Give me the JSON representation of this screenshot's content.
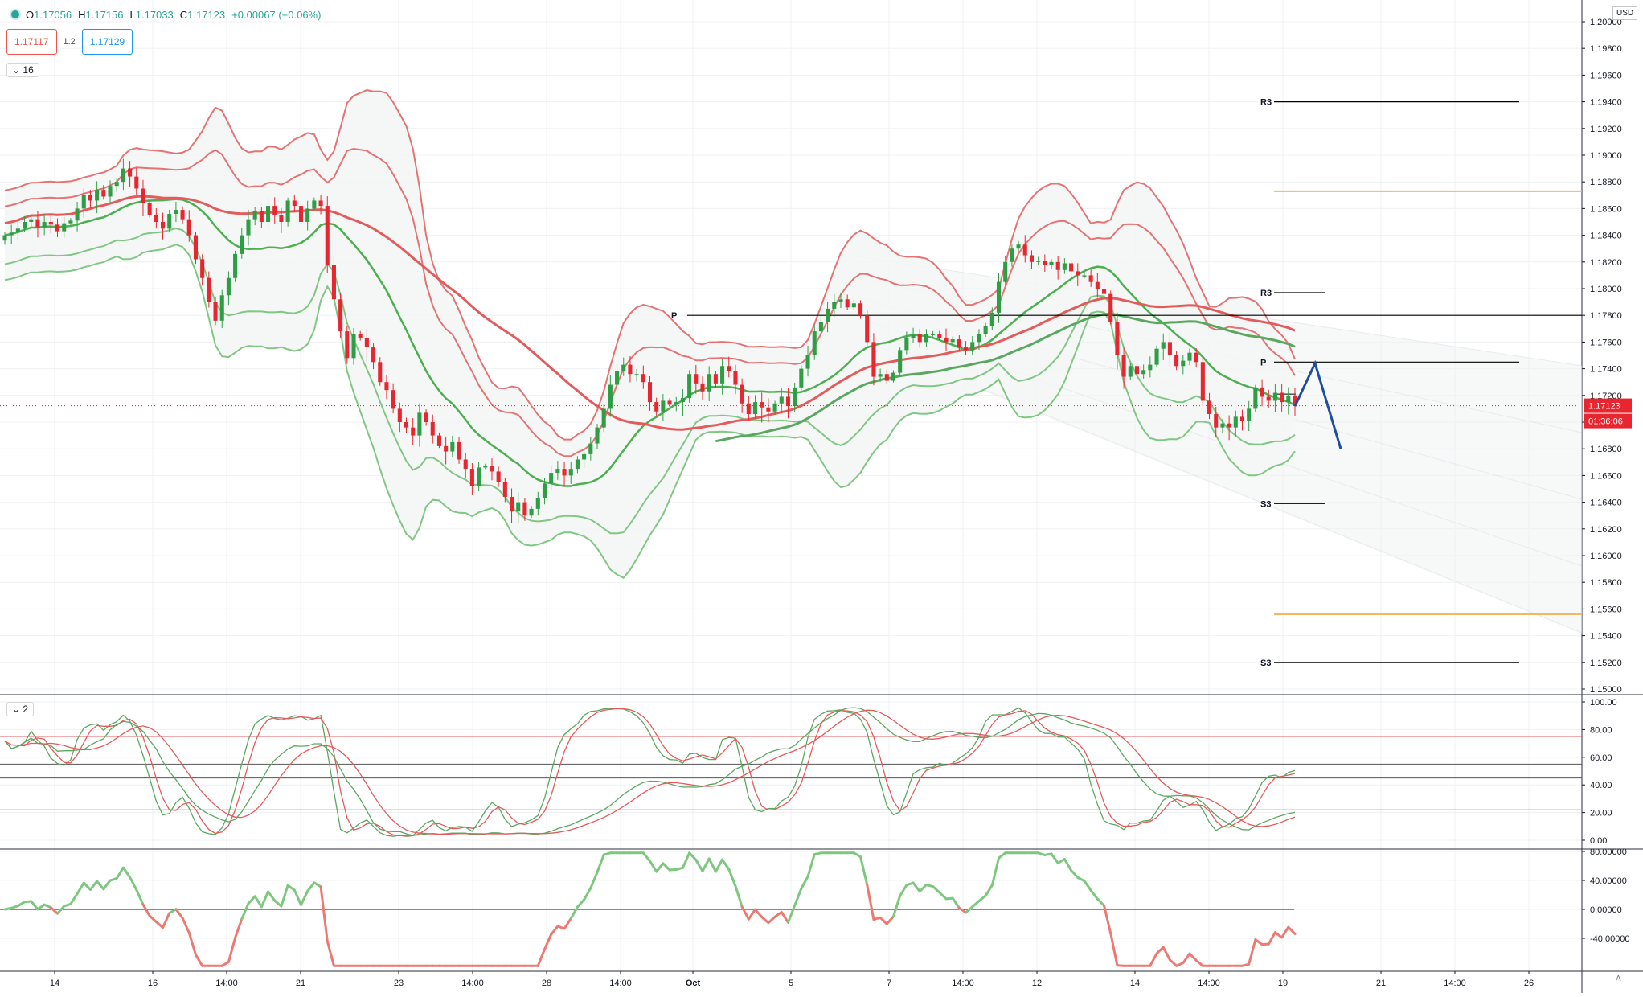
{
  "header": {
    "ohlc": [
      {
        "label": "O",
        "value": "1.17056"
      },
      {
        "label": "H",
        "value": "1.17156"
      },
      {
        "label": "L",
        "value": "1.17033"
      },
      {
        "label": "C",
        "value": "1.17123"
      },
      {
        "label": "",
        "value": "+0.00067 (+0.06%)"
      }
    ],
    "sell_price": "1.17117",
    "spread": "1.2",
    "buy_price": "1.17129",
    "main_collapse_count": "16",
    "osc_collapse_count": "2",
    "currency": "USD",
    "corner_label": "A"
  },
  "colors": {
    "up": "#2e9e45",
    "down": "#e8262f",
    "upper_band": "#e57373",
    "lower_band": "#81c784",
    "pivot_line": "#000000",
    "projection": "#1f4e9c",
    "orange": "#f0b860"
  },
  "chart_data": [
    {
      "type": "candlestick",
      "name": "price",
      "x_ticks": [
        "14",
        "16",
        "14:00",
        "21",
        "23",
        "14:00",
        "28",
        "14:00",
        "Oct",
        "5",
        "7",
        "14:00",
        "12",
        "14",
        "14:00",
        "19",
        "21",
        "14:00",
        "26"
      ],
      "y_ticks": [
        "1.20000",
        "1.19800",
        "1.19600",
        "1.19400",
        "1.19200",
        "1.19000",
        "1.18800",
        "1.18600",
        "1.18400",
        "1.18200",
        "1.18000",
        "1.17800",
        "1.17600",
        "1.17400",
        "1.17200",
        "1.17000",
        "1.16800",
        "1.16600",
        "1.16400",
        "1.16200",
        "1.16000",
        "1.15800",
        "1.15600",
        "1.15400",
        "1.15200",
        "1.15000"
      ],
      "ylim": [
        1.1495,
        1.2012
      ],
      "last_price": "1.17123",
      "countdown": "01:36:06",
      "closes": [
        1.184,
        1.1842,
        1.1845,
        1.185,
        1.1852,
        1.1846,
        1.185,
        1.1848,
        1.1843,
        1.1849,
        1.1851,
        1.186,
        1.187,
        1.1866,
        1.1874,
        1.1869,
        1.1877,
        1.188,
        1.189,
        1.1884,
        1.1875,
        1.1864,
        1.1855,
        1.185,
        1.1845,
        1.1856,
        1.1859,
        1.1852,
        1.184,
        1.1822,
        1.1808,
        1.179,
        1.1776,
        1.1795,
        1.1808,
        1.1826,
        1.184,
        1.1852,
        1.1858,
        1.185,
        1.1862,
        1.1855,
        1.185,
        1.1866,
        1.1862,
        1.185,
        1.186,
        1.1866,
        1.1862,
        1.1818,
        1.1792,
        1.1768,
        1.1748,
        1.1766,
        1.1763,
        1.1756,
        1.1745,
        1.173,
        1.1724,
        1.171,
        1.17,
        1.1696,
        1.169,
        1.1707,
        1.17,
        1.169,
        1.1682,
        1.1678,
        1.1685,
        1.1672,
        1.1665,
        1.1652,
        1.1666,
        1.1667,
        1.1663,
        1.1655,
        1.1644,
        1.1633,
        1.164,
        1.163,
        1.1635,
        1.1643,
        1.1654,
        1.1662,
        1.1665,
        1.166,
        1.1665,
        1.1672,
        1.1676,
        1.1684,
        1.1696,
        1.171,
        1.1728,
        1.1738,
        1.1743,
        1.1736,
        1.1736,
        1.173,
        1.1715,
        1.1708,
        1.1716,
        1.1713,
        1.1715,
        1.1718,
        1.1736,
        1.1729,
        1.1723,
        1.1736,
        1.1729,
        1.1742,
        1.1738,
        1.1728,
        1.1714,
        1.1706,
        1.1715,
        1.1711,
        1.1708,
        1.1714,
        1.1719,
        1.1712,
        1.1726,
        1.174,
        1.175,
        1.1768,
        1.1775,
        1.1785,
        1.179,
        1.1792,
        1.1786,
        1.1789,
        1.178,
        1.176,
        1.1734,
        1.1736,
        1.1731,
        1.1737,
        1.1754,
        1.1763,
        1.1766,
        1.176,
        1.1766,
        1.1766,
        1.1763,
        1.176,
        1.1762,
        1.1756,
        1.1754,
        1.176,
        1.1766,
        1.1772,
        1.1782,
        1.1805,
        1.182,
        1.183,
        1.1833,
        1.1825,
        1.182,
        1.1821,
        1.1818,
        1.182,
        1.1814,
        1.1819,
        1.1813,
        1.181,
        1.181,
        1.1805,
        1.18,
        1.1796,
        1.1775,
        1.175,
        1.1734,
        1.1742,
        1.1736,
        1.1739,
        1.1743,
        1.1755,
        1.176,
        1.175,
        1.1742,
        1.1746,
        1.1752,
        1.1745,
        1.1716,
        1.1706,
        1.1696,
        1.1699,
        1.1696,
        1.1704,
        1.1701,
        1.171,
        1.1726,
        1.1719,
        1.1716,
        1.1722,
        1.1715,
        1.172,
        1.1712
      ]
    },
    {
      "type": "line",
      "name": "stochastic",
      "y_ticks": [
        "100.00",
        "80.00",
        "60.00",
        "40.00",
        "20.00",
        "0.00"
      ],
      "ylim": [
        -4,
        106
      ],
      "levels": [
        75,
        55,
        45,
        22
      ]
    },
    {
      "type": "line",
      "name": "momentum",
      "y_ticks": [
        "80.00000",
        "40.00000",
        "0.00000",
        "-40.00000"
      ],
      "ylim": [
        -85,
        85
      ],
      "zero": 0
    }
  ],
  "pivots": {
    "top_group": [
      {
        "label": "R3",
        "price": 1.194
      },
      {
        "label": "",
        "price": 1.1873
      },
      {
        "label": "P",
        "price": 1.178
      },
      {
        "label": "",
        "price": 1.1556
      },
      {
        "label": "S3",
        "price": 1.152
      }
    ],
    "inner_group": [
      {
        "label": "R3",
        "price": 1.1797
      },
      {
        "label": "P",
        "price": 1.1745
      },
      {
        "label": "S3",
        "price": 1.1639
      }
    ]
  }
}
